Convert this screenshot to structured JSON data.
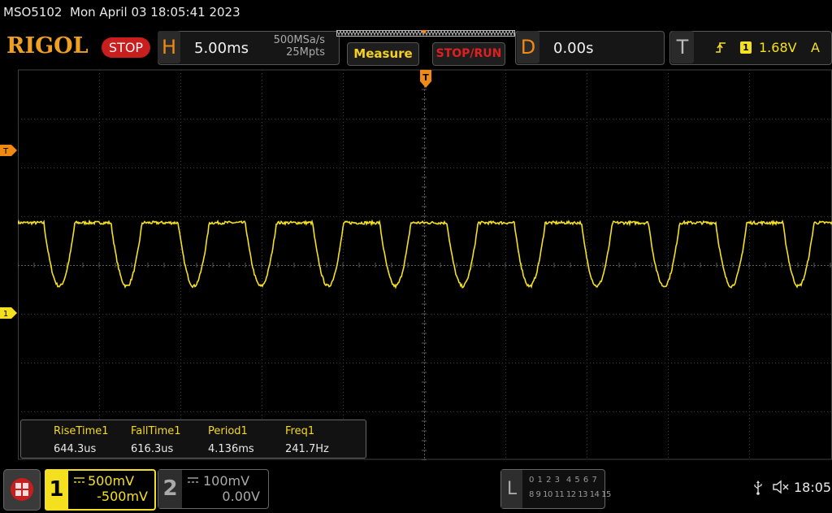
{
  "status_line": {
    "model": "MSO5102",
    "datetime": "Mon April 03 18:05:41 2023"
  },
  "header": {
    "logo": "RIGOL",
    "run_state": "STOP",
    "horizontal": {
      "letter": "H",
      "timebase": "5.00ms",
      "sample_rate": "500MSa/s",
      "memory_depth": "25Mpts"
    },
    "measure_button": "Measure",
    "stop_run_button": "STOP/RUN",
    "delay": {
      "letter": "D",
      "value": "0.00s"
    },
    "trigger": {
      "letter": "T",
      "slope_icon": "rising-edge-icon",
      "source": "1",
      "level": "1.68V",
      "mode": "A"
    }
  },
  "markers": {
    "trigger_position": "T",
    "trigger_level": "T",
    "ch1_ground": "1"
  },
  "measurements": [
    {
      "name": "RiseTime1",
      "value": "644.3us"
    },
    {
      "name": "FallTime1",
      "value": "616.3us"
    },
    {
      "name": "Period1",
      "value": "4.136ms"
    },
    {
      "name": "Freq1",
      "value": "241.7Hz"
    }
  ],
  "channels": {
    "ch1": {
      "number": "1",
      "scale": "500mV",
      "offset": "-500mV",
      "coupling_icon": "dc-coupling-icon",
      "color": "#f5e020"
    },
    "ch2": {
      "number": "2",
      "scale": "100mV",
      "offset": "0.00V",
      "coupling_icon": "dc-coupling-icon",
      "color": "#9a9a9a"
    }
  },
  "logic_analyzer": {
    "letter": "L",
    "row1": "0 1 2 3  4 5 6 7",
    "row2": "8 9 10 11 12 13 14 15"
  },
  "system": {
    "usb_icon": "usb-icon",
    "speaker_icon": "speaker-muted-icon",
    "clock": "18:05"
  },
  "waveform": {
    "channel": "1",
    "period_divisions": 0.827,
    "phase_divisions": 0.32,
    "high_level_divisions": 1.85,
    "low_level_divisions": 0.55,
    "noise_divisions": 0.03
  }
}
